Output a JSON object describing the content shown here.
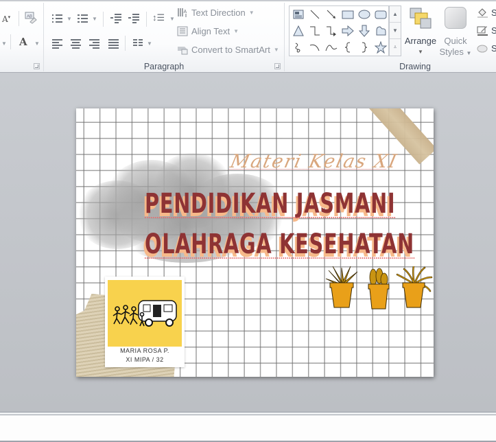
{
  "ribbon": {
    "groups": {
      "font": {
        "label": ""
      },
      "paragraph": {
        "label": "Paragraph"
      },
      "drawing": {
        "label": "Drawing"
      }
    },
    "font_controls": {
      "decrease_font_glyph": "A",
      "clear_format_glyph": "A",
      "font_color_glyph": "A"
    },
    "paragraph_commands": {
      "text_direction": "Text Direction",
      "align_text": "Align Text",
      "convert_smartart": "Convert to SmartArt"
    },
    "drawing": {
      "arrange": "Arrange",
      "quick_styles_line1": "Quick",
      "quick_styles_line2": "Styles",
      "shape_fill": "S",
      "shape_outline": "S",
      "shape_effects": "S"
    },
    "shapes_gallery": [
      "text-box",
      "line",
      "arrow-line",
      "rectangle",
      "oval",
      "rounded-rectangle",
      "triangle",
      "elbow-connector",
      "elbow-arrow-connector",
      "right-arrow",
      "down-arrow",
      "flowchart-shape",
      "freeform-scribble",
      "arc",
      "curve",
      "left-brace",
      "right-brace",
      "star"
    ]
  },
  "slide": {
    "subtitle": "Materi Kelas XI",
    "title_line1": "PENDIDIKAN JASMANI",
    "title_line2": "OLAHRAGA KESEHATAN",
    "polaroid_caption_line1": "MARIA ROSA P.",
    "polaroid_caption_line2": "XI MIPA / 32",
    "colors": {
      "title": "#8e3334",
      "title_shadow": "#f7b98a",
      "subtitle": "#d9a77e",
      "polaroid_bg": "#f8d24d",
      "pot": "#e9a019"
    }
  },
  "notes": {
    "text": ""
  }
}
